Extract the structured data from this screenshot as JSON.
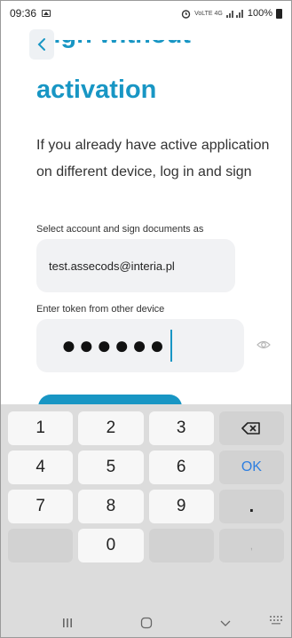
{
  "status": {
    "time": "09:36",
    "indicators": "VoLTE 4G",
    "battery_pct": "100%"
  },
  "header": {
    "title_top": "Sign without",
    "title_main": "activation"
  },
  "description": "If you already have active application on different device, log in and sign",
  "account": {
    "label": "Select account and sign documents as",
    "value": "test.assecods@interia.pl"
  },
  "token": {
    "label": "Enter token from other device",
    "value": "●●●●●●"
  },
  "keyboard": {
    "keys": [
      "1",
      "2",
      "3",
      "⌫",
      "4",
      "5",
      "6",
      "OK",
      "7",
      "8",
      "9",
      ".",
      "",
      "0",
      "",
      ","
    ]
  },
  "colors": {
    "accent": "#1896c4",
    "ok_key": "#2f7fe0"
  }
}
